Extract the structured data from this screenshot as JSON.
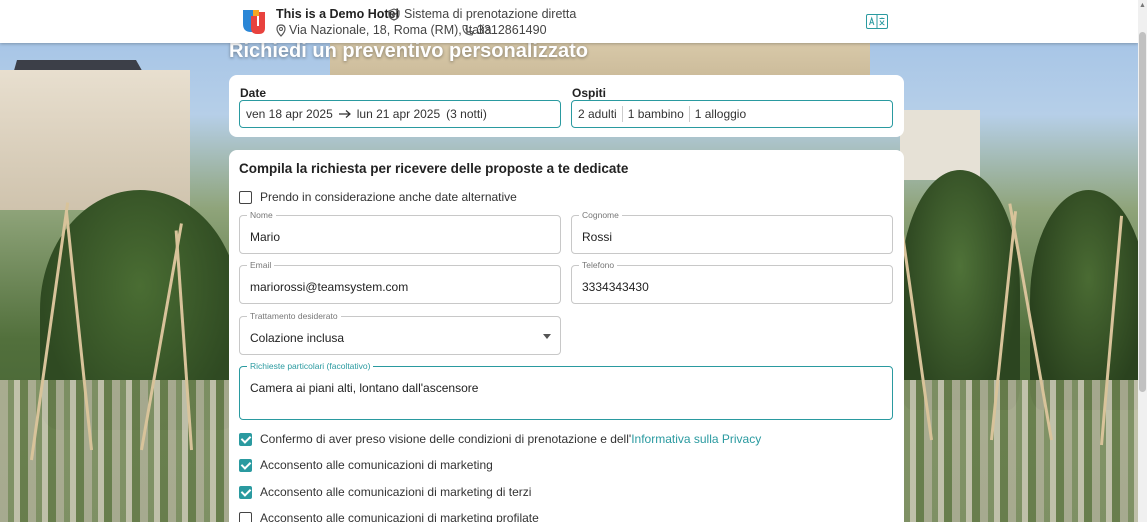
{
  "header": {
    "hotel_name": "This is a Demo Hotel",
    "tagline": "Sistema di prenotazione diretta",
    "address": "Via Nazionale, 18, Roma (RM), Italia",
    "phone": "3312861490"
  },
  "page": {
    "title": "Richiedi un preventivo personalizzato"
  },
  "search": {
    "date_title": "Date",
    "date_from": "ven 18 apr 2025",
    "date_to": "lun 21 apr 2025",
    "nights": "(3 notti)",
    "guests_title": "Ospiti",
    "adults": "2 adulti",
    "children": "1 bambino",
    "rooms": "1 alloggio"
  },
  "form": {
    "heading": "Compila la richiesta per ricevere delle proposte a te dedicate",
    "alt_dates_label": "Prendo in considerazione anche date alternative",
    "name_label": "Nome",
    "name_value": "Mario",
    "surname_label": "Cognome",
    "surname_value": "Rossi",
    "email_label": "Email",
    "email_value": "mariorossi@teamsystem.com",
    "phone_label": "Telefono",
    "phone_value": "3334343430",
    "treatment_label": "Trattamento desiderato",
    "treatment_value": "Colazione inclusa",
    "requests_label": "Richieste particolari (facoltativo)",
    "requests_value": "Camera ai piani alti, lontano dall'ascensore",
    "consent_terms": "Confermo di aver preso visione delle condizioni di prenotazione e dell'",
    "consent_terms_link": "Informativa sulla Privacy",
    "consent_marketing": "Acconsento alle comunicazioni di marketing",
    "consent_third_party": "Acconsento alle comunicazioni di marketing di terzi",
    "consent_profiled": "Acconsento alle comunicazioni di marketing profilate"
  },
  "colors": {
    "accent": "#2a9aa0"
  }
}
